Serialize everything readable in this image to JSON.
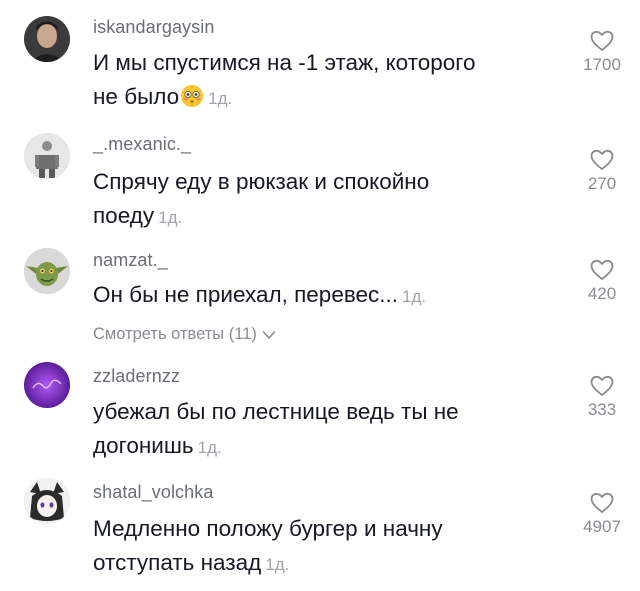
{
  "comments": [
    {
      "username": "iskandargaysin",
      "text": "И мы спустимся на -1 этаж, которого не было",
      "line1": "И мы спустимся на -1 этаж, которого",
      "line2": "не было",
      "emoji": "flushed-face",
      "time": "1д.",
      "likes": "1700"
    },
    {
      "username": "_.mexanic._",
      "text": "Спрячу еду в рюкзак и спокойно поеду",
      "line1": "Спрячу еду в рюкзак и спокойно",
      "line2": "поеду",
      "time": "1д.",
      "likes": "270"
    },
    {
      "username": "namzat._",
      "text": "Он бы не приехал, перевес...",
      "line1": "Он бы не приехал, перевес...",
      "time": "1д.",
      "likes": "420"
    },
    {
      "username": "zzladernzz",
      "text": "убежал бы по лестнице ведь ты не догонишь",
      "line1": "убежал бы по лестнице ведь ты не",
      "line2": "догонишь",
      "time": "1д.",
      "likes": "333"
    },
    {
      "username": "shatal_volchka",
      "text": "Медленно положу бургер и начну отступать назад",
      "line1": "Медленно положу бургер и начну",
      "line2": "отступать назад",
      "time": "1д.",
      "likes": "4907"
    }
  ],
  "view_replies": "Смотреть ответы (11)",
  "colors": {
    "username": "#6b6d76",
    "text": "#161823",
    "meta": "#a3a4ab",
    "icon": "#8a8b91"
  }
}
